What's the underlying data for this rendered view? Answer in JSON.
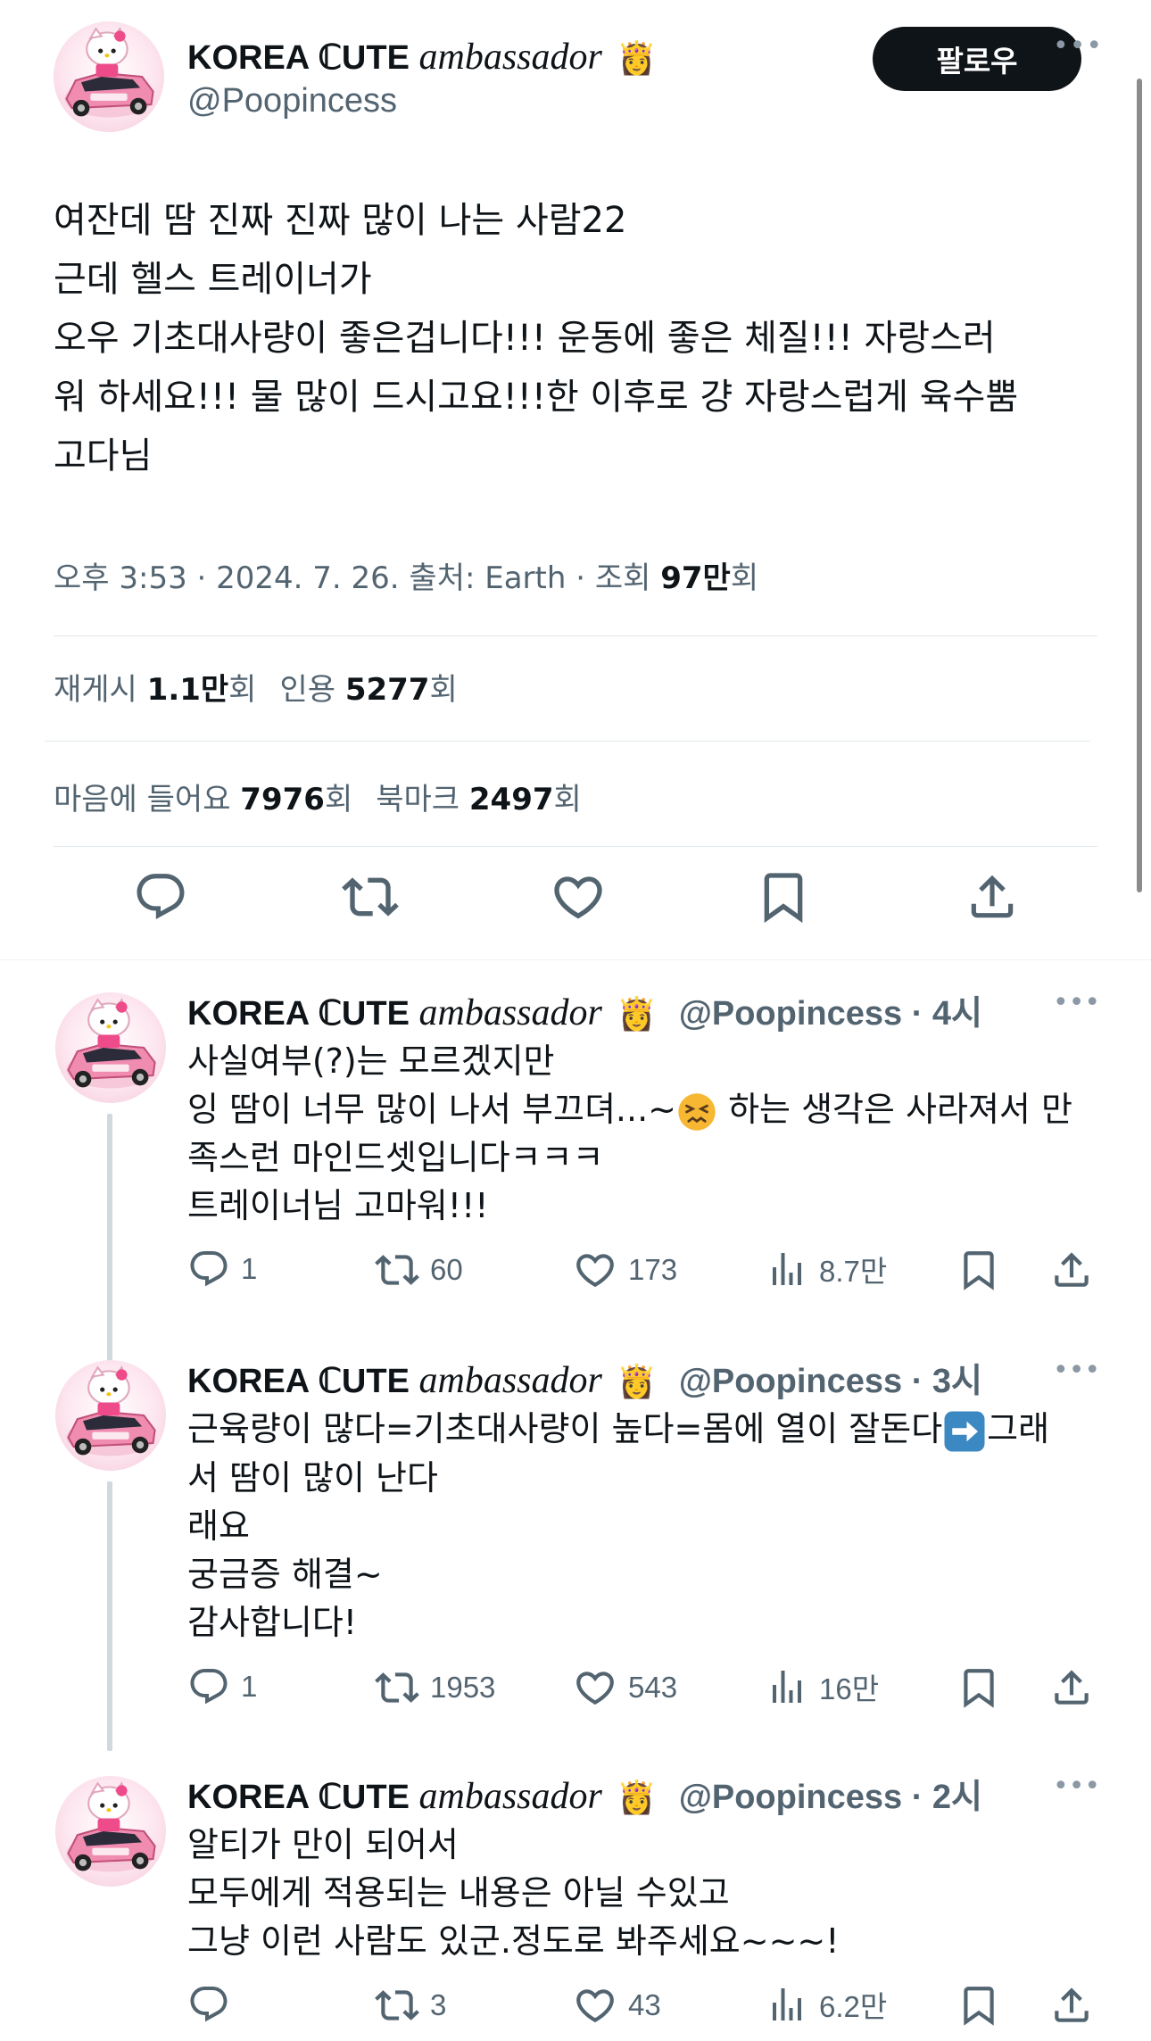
{
  "main_tweet": {
    "display_name": "KOREA ℂUTE",
    "display_name_italic": "ambassador",
    "crown": "👸",
    "handle": "@Poopincess",
    "follow_label": "팔로우",
    "text_lines": [
      "여잔데 땀 진짜 진짜 많이 나는 사람22",
      "근데 헬스 트레이너가",
      "오우 기초대사량이 좋은겁니다!!! 운동에 좋은 체질!!! 자랑스러",
      "워 하세요!!! 물 많이 드시고요!!!한 이후로 걍 자랑스럽게 육수뿜",
      "고다님"
    ],
    "meta": {
      "time_date_source": "오후 3:53 · 2024. 7. 26. 출처: Earth · 조회 ",
      "views_value": "97만",
      "views_suffix": "회"
    },
    "stats": {
      "reposts_label": "재게시 ",
      "reposts_value": "1.1만",
      "reposts_suffix": "회",
      "quotes_label": "인용 ",
      "quotes_value": "5277",
      "quotes_suffix": "회",
      "likes_label": "마음에 들어요 ",
      "likes_value": "7976",
      "likes_suffix": "회",
      "bookmarks_label": "북마크 ",
      "bookmarks_value": "2497",
      "bookmarks_suffix": "회"
    }
  },
  "replies": [
    {
      "display_name": "KOREA ℂUTE",
      "display_name_italic": "ambassador",
      "crown": "👸",
      "handle_time": "@Poopincess · 4시",
      "lines": [
        "사실여부(?)는 모르겠지만",
        "잉 땀이 너무 많이 나서 부끄뎌...~",
        " 하는 생각은 사라져서 만",
        "족스런 마인드셋입니다ㅋㅋㅋ",
        "트레이너님 고마워!!!"
      ],
      "replies": "1",
      "reposts": "60",
      "likes": "173",
      "views": "8.7만"
    },
    {
      "display_name": "KOREA ℂUTE",
      "display_name_italic": "ambassador",
      "crown": "👸",
      "handle_time": "@Poopincess · 3시",
      "lines": [
        "근육량이 많다=기초대사량이 높다=몸에 열이 잘돈다",
        "그래",
        "서 땀이 많이 난다",
        "래요",
        "궁금증 해결~",
        "감사합니다!"
      ],
      "replies": "1",
      "reposts": "1953",
      "likes": "543",
      "views": "16만"
    },
    {
      "display_name": "KOREA ℂUTE",
      "display_name_italic": "ambassador",
      "crown": "👸",
      "handle_time": "@Poopincess · 2시",
      "lines": [
        "알티가 만이 되어서",
        "모두에게 적용되는 내용은 아닐 수있고",
        "그냥 이런 사람도 있군.정도로 봐주세요~~~!"
      ],
      "replies": "",
      "reposts": "3",
      "likes": "43",
      "views": "6.2만"
    }
  ],
  "colors": {
    "text": "#0f1419",
    "muted": "#536471",
    "divider": "#e1e8ed",
    "thread_line": "#cfd9de",
    "follow_bg": "#0f1419"
  },
  "icons": [
    "reply-icon",
    "repost-icon",
    "like-icon",
    "bookmark-icon",
    "share-icon",
    "views-icon",
    "more-icon"
  ]
}
